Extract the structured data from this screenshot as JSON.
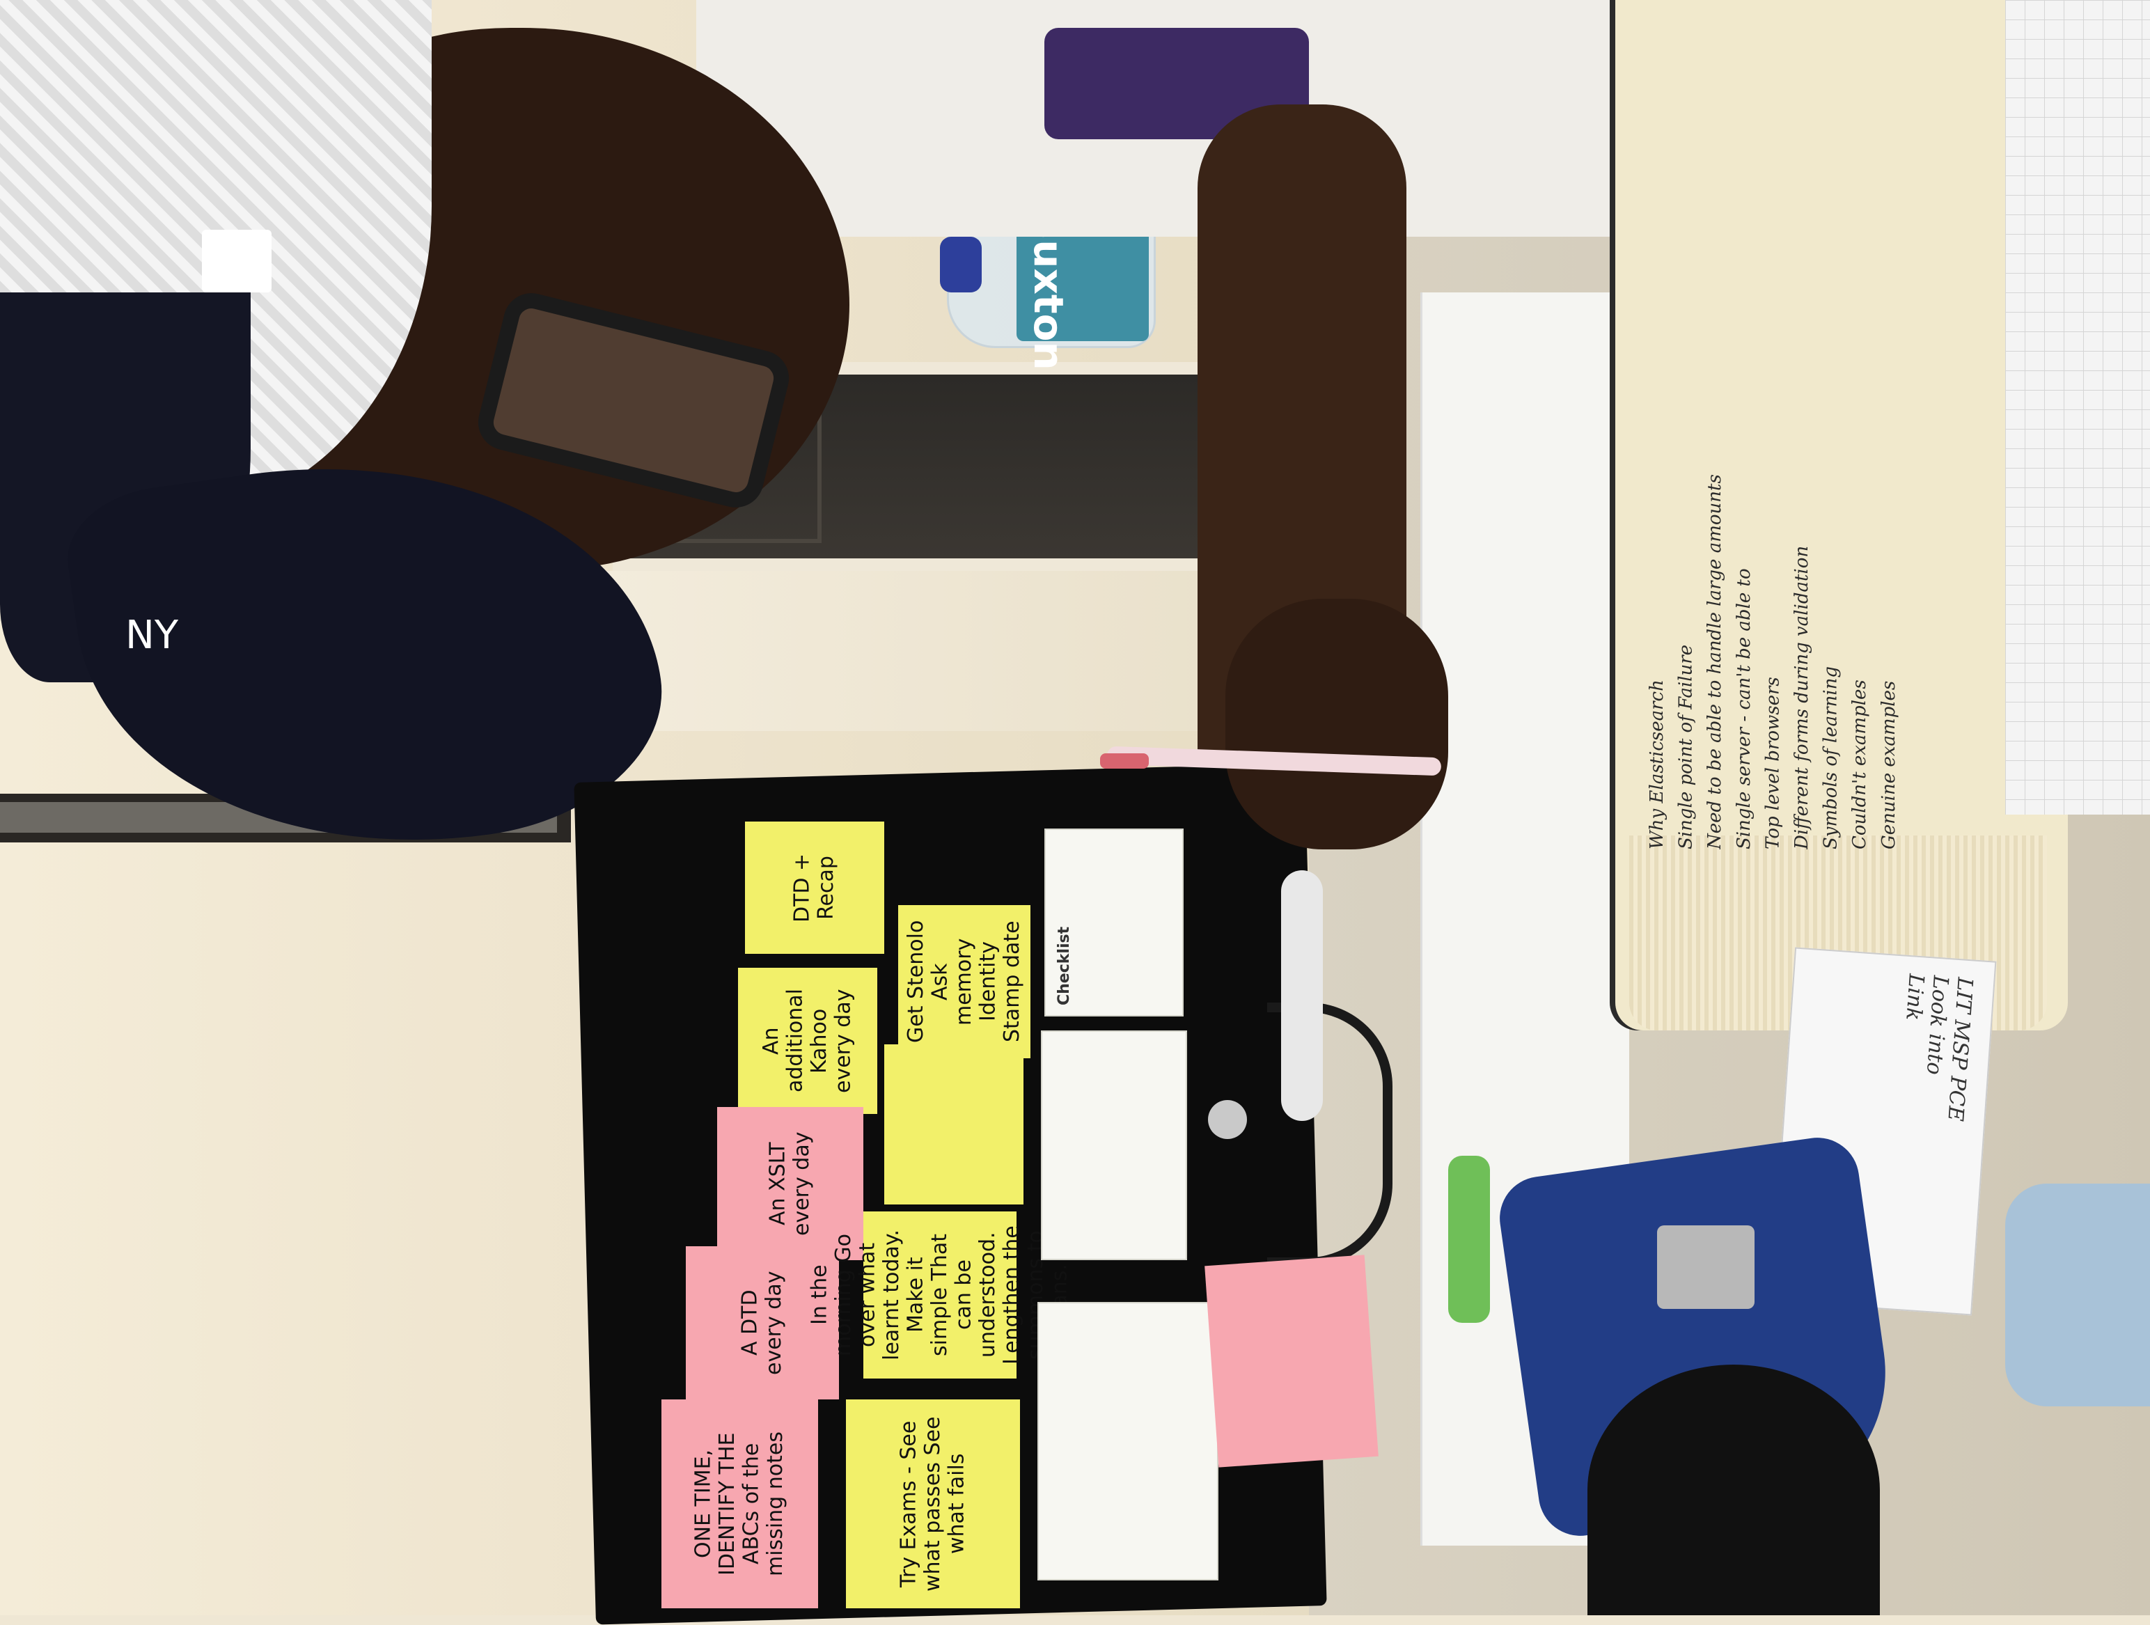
{
  "scene": {
    "cap_logo": "NY",
    "bottle_brand": "Buxton"
  },
  "sticky_notes": {
    "top_row": [
      {
        "text": "DTD + Recap",
        "color": "yellow"
      },
      {
        "text": "An additional Kahoo every day",
        "color": "yellow"
      },
      {
        "text": "An XSLT every day",
        "color": "pink"
      },
      {
        "text": "A DTD every day",
        "color": "pink"
      },
      {
        "text": "ONE TIME, IDENTIFY THE ABCs of the missing notes",
        "color": "pink"
      }
    ],
    "middle_row": [
      {
        "text": "Get Stenolo Ask memory Identity Stamp date",
        "color": "yellow"
      },
      {
        "text": "",
        "color": "yellow"
      },
      {
        "text": "In the morning Go over what learnt today. Make it simple That can be understood. Lengthen the summons to plans.",
        "color": "yellow"
      },
      {
        "text": "Try Exams - See what passes See what fails",
        "color": "yellow"
      }
    ],
    "bottom_pink": {
      "text": "",
      "color": "pink"
    }
  },
  "cards": [
    {
      "title": "Checklist",
      "lines": [
        "",
        "",
        "",
        "",
        "",
        ""
      ]
    },
    {
      "title": "",
      "lines": [
        "",
        "",
        "",
        "",
        "",
        "",
        "",
        ""
      ]
    },
    {
      "title": "",
      "lines": [
        "",
        "",
        "",
        "",
        "",
        "",
        "",
        "",
        ""
      ]
    }
  ],
  "notebook": {
    "lines": [
      "Why Elasticsearch",
      "Single point of Failure",
      "Need to be able to handle large amounts",
      "Single server - can't be able to",
      "Top level browsers",
      "Different forms during validation",
      "Symbols of learning",
      "Couldn't examples",
      "Genuine examples"
    ]
  },
  "index_card": {
    "lines": [
      "LIT MSP PCE",
      "Look into",
      "Link"
    ]
  }
}
